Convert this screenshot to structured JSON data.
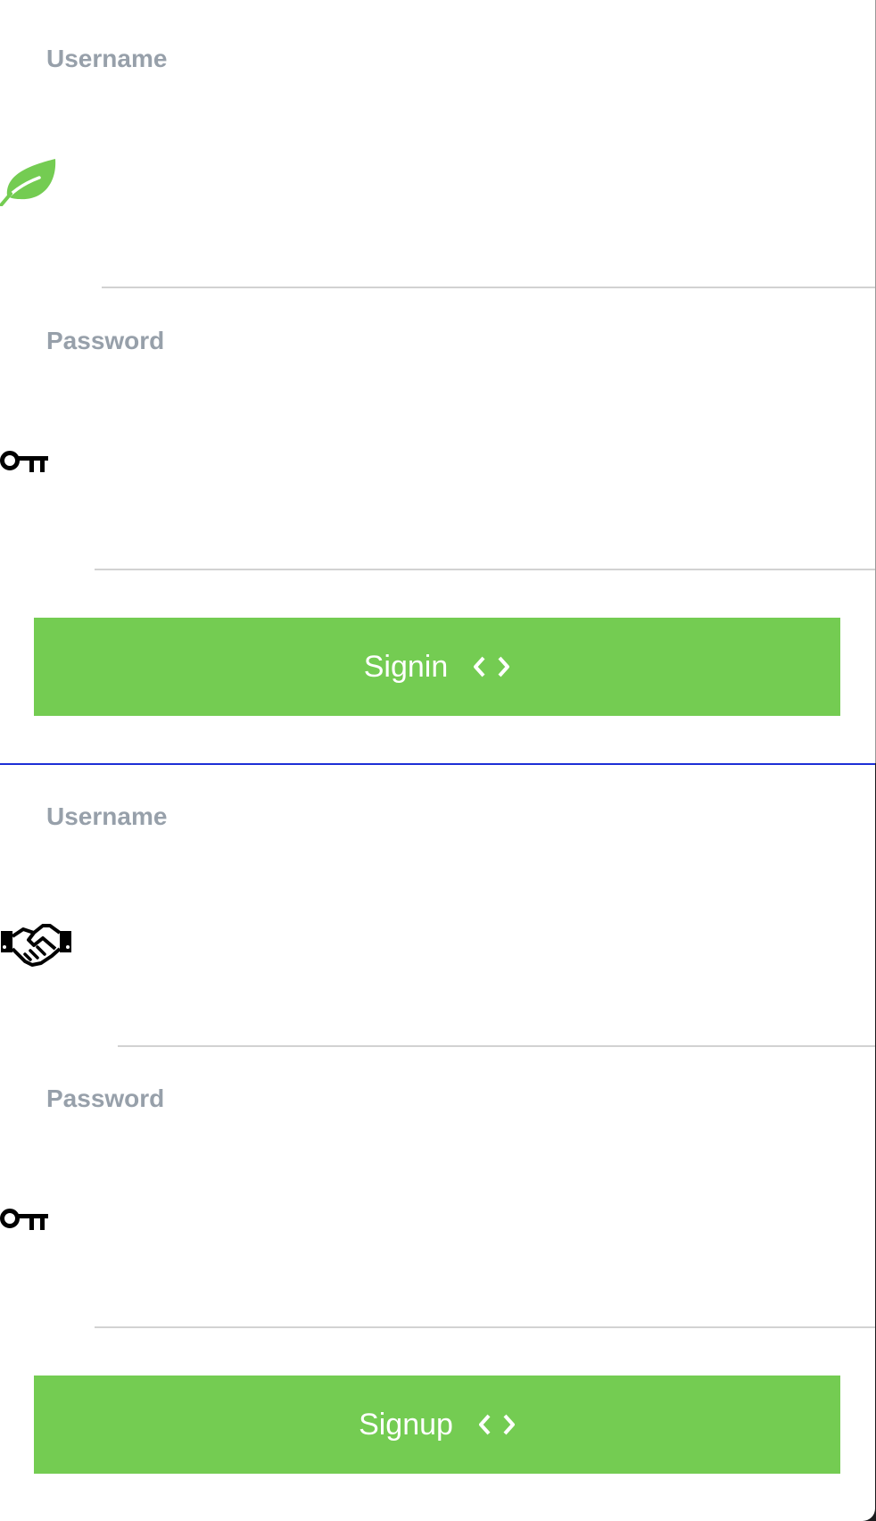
{
  "signin": {
    "username": {
      "label": "Username",
      "value": "",
      "icon": "leaf-icon"
    },
    "password": {
      "label": "Password",
      "value": "",
      "icon": "key-icon"
    },
    "button": {
      "label": "Signin",
      "icon": "code-icon"
    }
  },
  "signup": {
    "username": {
      "label": "Username",
      "value": "",
      "icon": "handshake-icon"
    },
    "password": {
      "label": "Password",
      "value": "",
      "icon": "key-icon"
    },
    "button": {
      "label": "Signup",
      "icon": "code-icon"
    }
  },
  "colors": {
    "accent": "#74cc52",
    "label": "#97a0aa",
    "divider": "#1d2fd6",
    "underline": "#d2d2d2"
  }
}
